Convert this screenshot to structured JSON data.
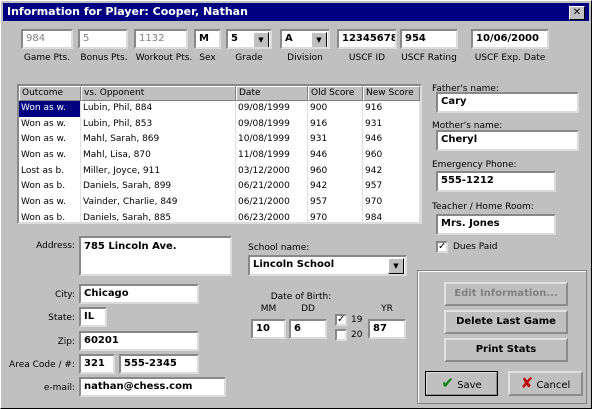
{
  "window": {
    "title": "Information for Player: Cooper, Nathan",
    "close": "✕"
  },
  "stats": {
    "game_pts": "984",
    "bonus_pts": "5",
    "workout_pts": "1132",
    "sex": "M",
    "grade": "5",
    "division": "A",
    "uscf_id": "12345678",
    "uscf_rating": "954",
    "uscf_exp": "10/06/2000"
  },
  "stat_labels": {
    "game_pts": "Game Pts.",
    "bonus_pts": "Bonus Pts.",
    "workout_pts": "Workout Pts.",
    "sex": "Sex",
    "grade": "Grade",
    "division": "Division",
    "uscf_id": "USCF ID",
    "uscf_rating": "USCF Rating",
    "uscf_exp": "USCF Exp. Date"
  },
  "table": {
    "headers": [
      "Outcome",
      "vs. Opponent",
      "Date",
      "Old Score",
      "New Score"
    ],
    "rows": [
      [
        "Won as w.",
        "Lubin, Phil, 884",
        "09/08/1999",
        "900",
        "916"
      ],
      [
        "Won as w.",
        "Lubin, Phil, 853",
        "09/08/1999",
        "916",
        "931"
      ],
      [
        "Won as w.",
        "Mahl, Sarah, 869",
        "10/08/1999",
        "931",
        "946"
      ],
      [
        "Won as w.",
        "Mahl, Lisa, 870",
        "11/08/1999",
        "946",
        "960"
      ],
      [
        "Lost as b.",
        "Miller, Joyce, 911",
        "03/12/2000",
        "960",
        "942"
      ],
      [
        "Won as b.",
        "Daniels, Sarah, 899",
        "06/21/2000",
        "942",
        "957"
      ],
      [
        "Won as w.",
        "Vainder, Charlie, 849",
        "06/21/2000",
        "957",
        "970"
      ],
      [
        "Won as b.",
        "Daniels, Sarah, 885",
        "06/23/2000",
        "970",
        "984"
      ]
    ]
  },
  "right": {
    "father_label": "Father's name:",
    "father": "Cary",
    "mother_label": "Mother's name:",
    "mother": "Cheryl",
    "emergency_label": "Emergency Phone:",
    "emergency": "555-1212",
    "teacher_label": "Teacher / Home Room:",
    "teacher": "Mrs. Jones",
    "dues_label": "Dues Paid"
  },
  "address": {
    "address_label": "Address:",
    "address": "785 Lincoln Ave.",
    "city_label": "City:",
    "city": "Chicago",
    "state_label": "State:",
    "state": "IL",
    "zip_label": "Zip:",
    "zip": "60201",
    "phone_label": "Area Code / #:",
    "area": "321",
    "phone": "555-2345",
    "email_label": "e-mail:",
    "email": "nathan@chess.com"
  },
  "school": {
    "label": "School name:",
    "value": "Lincoln School"
  },
  "dob": {
    "label": "Date of Birth:",
    "mm_label": "MM",
    "dd_label": "DD",
    "yr_label": "YR",
    "mm": "10",
    "dd": "6",
    "c19": "19",
    "c20": "20",
    "yr": "87"
  },
  "buttons": {
    "edit": "Edit Information...",
    "delete": "Delete Last Game",
    "print": "Print Stats",
    "save": "Save",
    "cancel": "Cancel"
  },
  "colors": {
    "titlebar": "#000080",
    "selection": "#000080",
    "save_icon": "#008000",
    "cancel_icon": "#c00000"
  }
}
